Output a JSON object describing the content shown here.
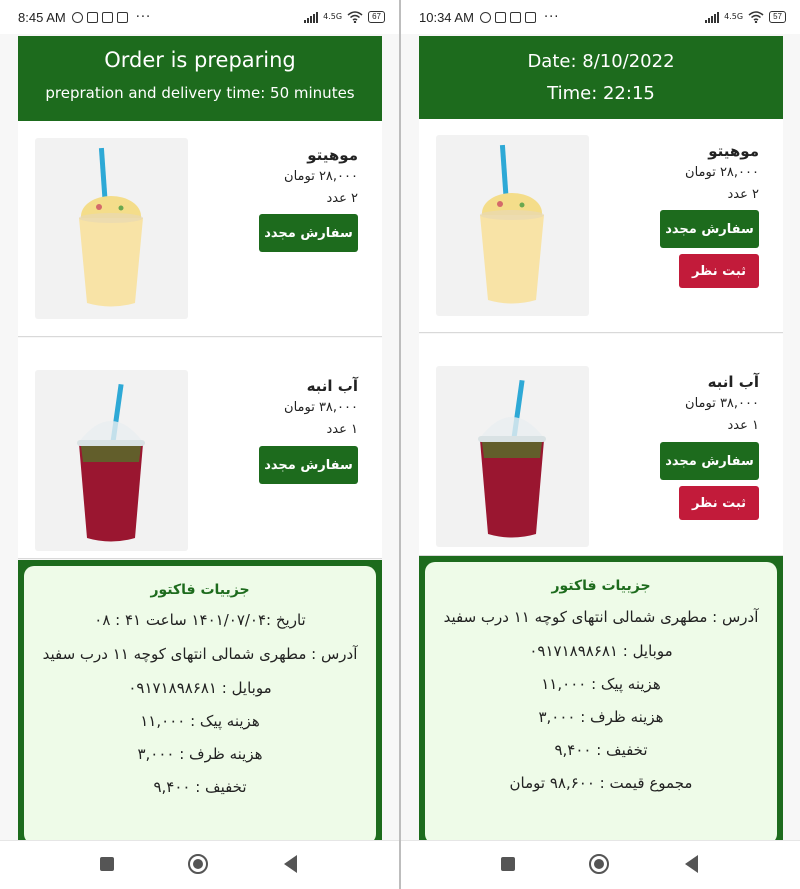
{
  "left": {
    "status": {
      "time": "8:45 AM",
      "network": "4.5G",
      "battery": "67"
    },
    "header": {
      "title": "Order is preparing",
      "subtitle": "prepration and delivery time: 50 minutes"
    },
    "items": [
      {
        "name": "موهیتو",
        "price": "۲۸,۰۰۰ تومان",
        "qty": "۲ عدد",
        "reorder_label": "سفارش مجدد",
        "image": "smoothie-cup-icon"
      },
      {
        "name": "آب انبه",
        "price": "۳۸,۰۰۰ تومان",
        "qty": "۱ عدد",
        "reorder_label": "سفارش مجدد",
        "image": "red-drink-cup-icon"
      }
    ],
    "invoice": {
      "title": "جزییات فاکتور",
      "date": "تاریخ :۱۴۰۱/۰۷/۰۴ ساعت ۴۱ : ۰۸",
      "address": "آدرس : مطهری شمالی انتهای کوچه ۱۱ درب سفید",
      "mobile": "موبایل : ۰۹۱۷۱۸۹۸۶۸۱",
      "delivery_fee": "هزینه پیک : ۱۱,۰۰۰",
      "container_fee": "هزینه ظرف : ۳,۰۰۰",
      "discount": "تخفیف : ۹,۴۰۰"
    }
  },
  "right": {
    "status": {
      "time": "10:34 AM",
      "network": "4.5G",
      "battery": "57"
    },
    "header": {
      "title": "Date: 8/10/2022",
      "subtitle": "Time: 22:15"
    },
    "items": [
      {
        "name": "موهیتو",
        "price": "۲۸,۰۰۰ تومان",
        "qty": "۲ عدد",
        "reorder_label": "سفارش مجدد",
        "review_label": "ثبت نظر",
        "image": "smoothie-cup-icon"
      },
      {
        "name": "آب انبه",
        "price": "۳۸,۰۰۰ تومان",
        "qty": "۱ عدد",
        "reorder_label": "سفارش مجدد",
        "review_label": "ثبت نظر",
        "image": "red-drink-cup-icon"
      }
    ],
    "invoice": {
      "title": "جزییات فاکتور",
      "address": "آدرس : مطهری شمالی انتهای کوچه ۱۱ درب سفید",
      "mobile": "موبایل : ۰۹۱۷۱۸۹۸۶۸۱",
      "delivery_fee": "هزینه پیک : ۱۱,۰۰۰",
      "container_fee": "هزینه ظرف : ۳,۰۰۰",
      "discount": "تخفیف : ۹,۴۰۰",
      "total": "مجموع قیمت : ۹۸,۶۰۰ تومان"
    }
  },
  "colors": {
    "brand_green": "#1d6b1d",
    "review_red": "#c21b3a",
    "invoice_bg": "#eefbe8"
  }
}
